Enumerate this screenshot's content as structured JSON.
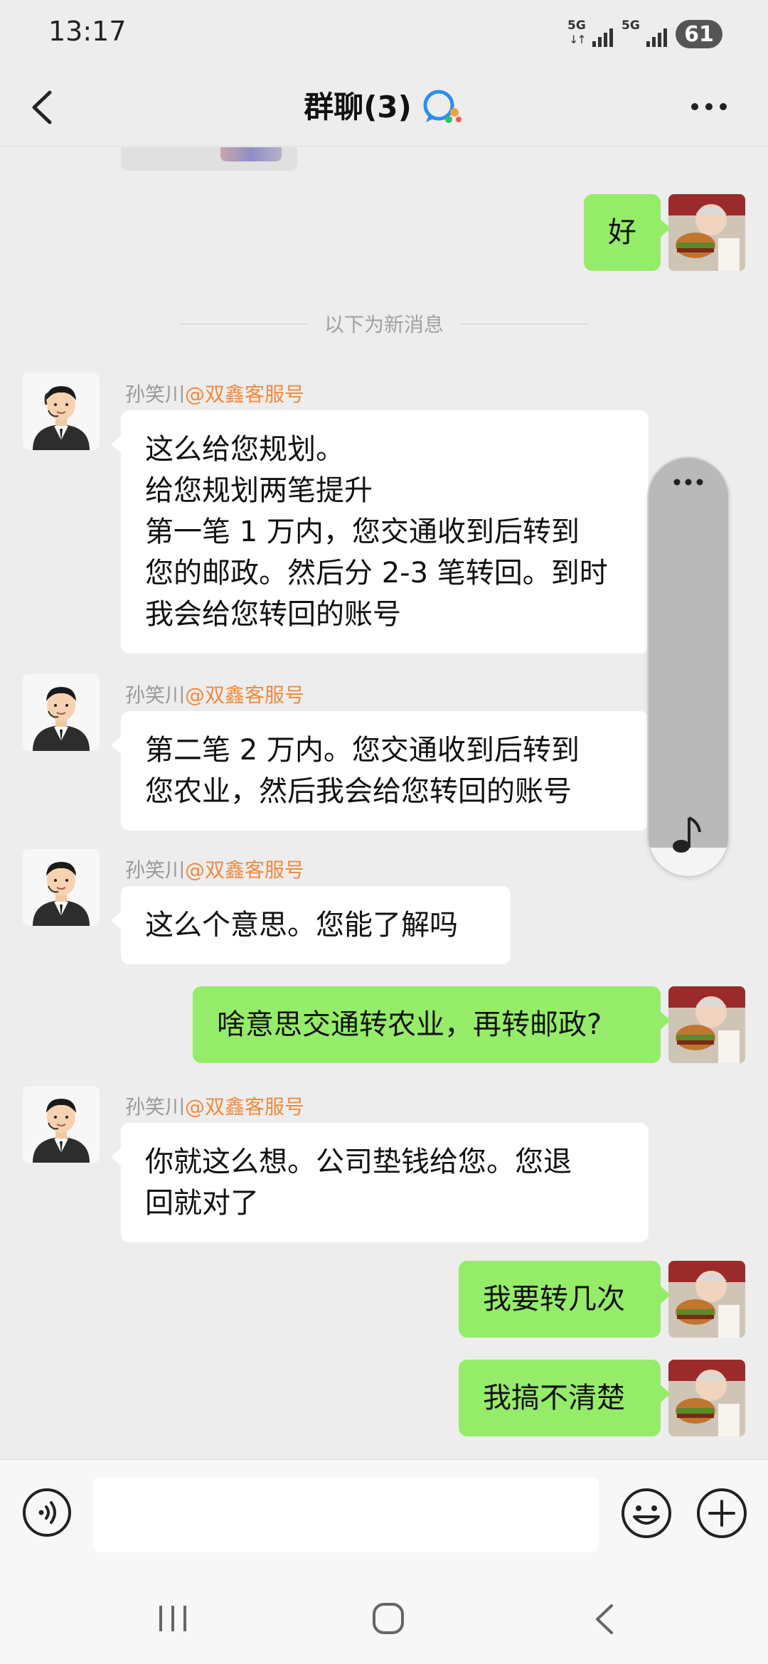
{
  "status_bar": {
    "time": "13:17",
    "signal1_label": "5G",
    "signal2_label": "5G",
    "battery": "61"
  },
  "header": {
    "title": "群聊(3)"
  },
  "divider_text": "以下为新消息",
  "messages": [
    {
      "side": "right",
      "text": "好"
    },
    {
      "side": "left",
      "sender_name": "孙笑川",
      "sender_org": "@双鑫客服号",
      "lines": [
        "这么给您规划。",
        "给您规划两笔提升",
        "第一笔 1 万内，您交通收到后转到",
        "您的邮政。然后分 2-3 笔转回。到时",
        "我会给您转回的账号"
      ]
    },
    {
      "side": "left",
      "sender_name": "孙笑川",
      "sender_org": "@双鑫客服号",
      "lines": [
        "第二笔 2 万内。您交通收到后转到",
        "您农业，然后我会给您转回的账号"
      ]
    },
    {
      "side": "left",
      "sender_name": "孙笑川",
      "sender_org": "@双鑫客服号",
      "lines": [
        "这么个意思。您能了解吗"
      ]
    },
    {
      "side": "right",
      "text": "啥意思交通转农业，再转邮政?"
    },
    {
      "side": "left",
      "sender_name": "孙笑川",
      "sender_org": "@双鑫客服号",
      "lines": [
        "你就这么想。公司垫钱给您。您退",
        "回就对了"
      ]
    },
    {
      "side": "right",
      "text": "我要转几次"
    },
    {
      "side": "right",
      "text": "我搞不清楚"
    }
  ],
  "input": {
    "value": ""
  },
  "colors": {
    "background": "#ededed",
    "my_bubble": "#95ec69",
    "their_bubble": "#ffffff",
    "at_mention": "#f08a3e"
  },
  "icons": {
    "back": "chevron-left-icon",
    "group_badge": "chat-bubbles-icon",
    "more": "ellipsis-icon",
    "voice": "voice-icon",
    "emoji": "smiley-icon",
    "plus": "plus-icon",
    "float_note": "music-note-icon"
  }
}
